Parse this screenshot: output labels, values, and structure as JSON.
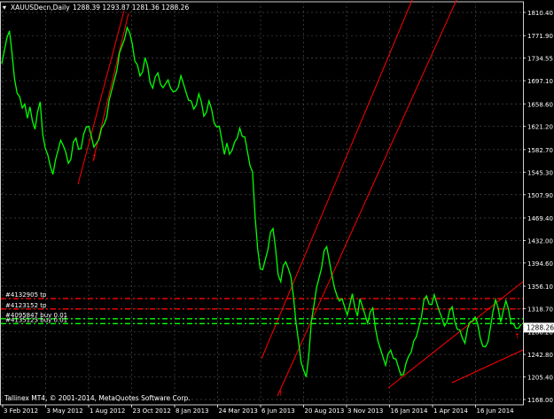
{
  "header": {
    "symbol": "XAUUSDecn,Daily",
    "ohlc": "1288.39 1293.87 1281.36 1288.26"
  },
  "footer": {
    "copyright": "Tallinex MT4, © 2001-2014, MetaQuotes Software Corp."
  },
  "current_price_label": "1288.26",
  "colors": {
    "background": "#000000",
    "candles": "#00ff00",
    "grid": "#4a4a4a",
    "axis_text": "#ffffff",
    "trendlines": "#ff0000",
    "tp_lines": "#ff0000",
    "buy_lines": "#00ff00",
    "price_tag_bg": "#ffffff"
  },
  "orders": [
    {
      "label": "#4132905 tp",
      "price": 1335.5,
      "color": "#ff0000"
    },
    {
      "label": "#4123152 tp",
      "price": 1318.2,
      "color": "#ff0000"
    },
    {
      "label": "#4095847 buy 0.01",
      "price": 1302.0,
      "color": "#00ff00"
    },
    {
      "label": "#4135123 buy 0.01",
      "price": 1294.0,
      "color": "#00ff00"
    }
  ],
  "chart_data": {
    "type": "line",
    "title": "XAUUSDecn,Daily",
    "y_ticks": [
      "1810.40",
      "1771.90",
      "1734.55",
      "1697.10",
      "1658.60",
      "1621.20",
      "1582.70",
      "1545.30",
      "1507.90",
      "1469.40",
      "1432.00",
      "1394.60",
      "1356.10",
      "1318.70",
      "1280.20",
      "1242.80",
      "1205.40",
      "1168.00"
    ],
    "y_tick_values": [
      1810.4,
      1771.9,
      1734.55,
      1697.1,
      1658.6,
      1621.2,
      1582.7,
      1545.3,
      1507.9,
      1469.4,
      1432.0,
      1394.6,
      1356.1,
      1318.7,
      1280.2,
      1242.8,
      1205.4,
      1168.0
    ],
    "x_ticks": [
      "3 Feb 2012",
      "3 May 2012",
      "1 Aug 2012",
      "23 Oct 2012",
      "8 Jan 2013",
      "24 Mar 2013",
      "6 Jun 2013",
      "20 Aug 2013",
      "3 Nov 2013",
      "16 Jan 2014",
      "1 Apr 2014",
      "16 Jun 2014"
    ],
    "ylim": [
      1160.0,
      1818.0
    ],
    "grid": true,
    "series": [
      {
        "values": [
          1720,
          1745,
          1770,
          1785,
          1740,
          1700,
          1680,
          1665,
          1650,
          1660,
          1640,
          1650,
          1630,
          1620,
          1640,
          1660,
          1610,
          1590,
          1570,
          1555,
          1545,
          1560,
          1580,
          1600,
          1595,
          1575,
          1560,
          1570,
          1590,
          1600,
          1585,
          1590,
          1605,
          1620,
          1625,
          1600,
          1585,
          1595,
          1605,
          1615,
          1625,
          1640,
          1660,
          1680,
          1700,
          1720,
          1740,
          1755,
          1770,
          1780,
          1775,
          1760,
          1735,
          1720,
          1705,
          1715,
          1730,
          1720,
          1695,
          1690,
          1700,
          1710,
          1695,
          1680,
          1690,
          1700,
          1690,
          1675,
          1680,
          1690,
          1700,
          1690,
          1680,
          1670,
          1660,
          1650,
          1660,
          1670,
          1660,
          1640,
          1650,
          1660,
          1650,
          1630,
          1615,
          1620,
          1600,
          1580,
          1590,
          1575,
          1585,
          1590,
          1600,
          1620,
          1610,
          1600,
          1580,
          1560,
          1540,
          1470,
          1420,
          1390,
          1380,
          1400,
          1420,
          1440,
          1450,
          1420,
          1380,
          1360,
          1390,
          1400,
          1380,
          1370,
          1340,
          1300,
          1260,
          1230,
          1220,
          1200,
          1240,
          1300,
          1330,
          1350,
          1370,
          1390,
          1410,
          1420,
          1400,
          1380,
          1350,
          1340,
          1335,
          1330,
          1320,
          1310,
          1330,
          1340,
          1320,
          1310,
          1330,
          1320,
          1310,
          1300,
          1310,
          1320,
          1290,
          1260,
          1250,
          1240,
          1230,
          1240,
          1250,
          1240,
          1230,
          1220,
          1210,
          1215,
          1225,
          1240,
          1250,
          1260,
          1270,
          1290,
          1310,
          1330,
          1340,
          1330,
          1320,
          1340,
          1330,
          1320,
          1300,
          1290,
          1300,
          1310,
          1320,
          1300,
          1290,
          1280,
          1270,
          1265,
          1280,
          1295,
          1300,
          1310,
          1290,
          1270,
          1260,
          1250,
          1262,
          1290,
          1320,
          1330,
          1320,
          1300,
          1310,
          1330,
          1320,
          1300,
          1290,
          1286,
          1290,
          1288
        ]
      }
    ]
  }
}
